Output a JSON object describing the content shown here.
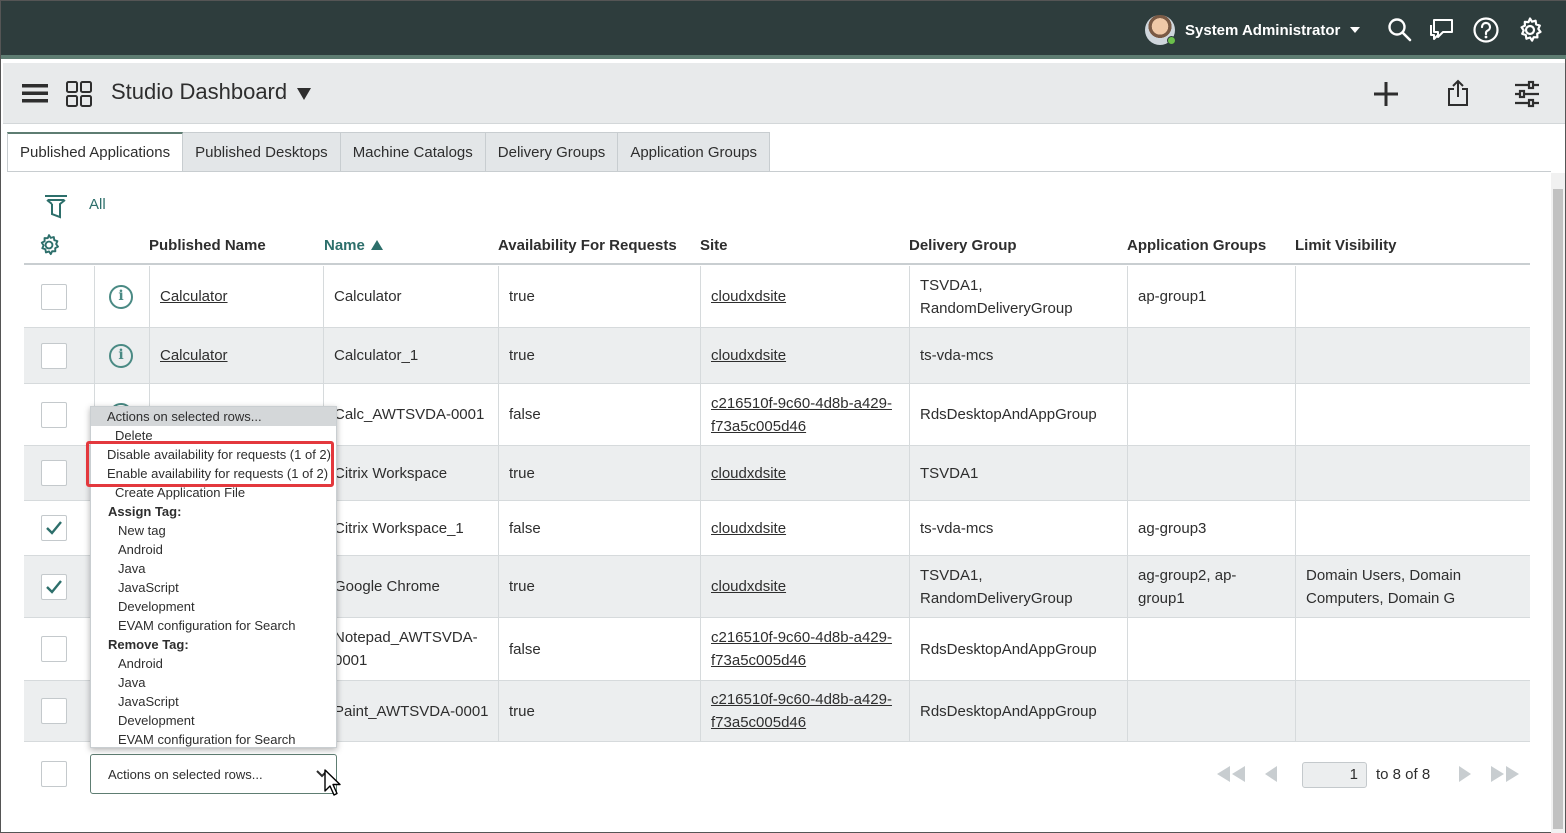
{
  "topbar": {
    "user_name": "System Administrator",
    "icons": [
      "search-icon",
      "chat-icon",
      "help-icon",
      "settings-gear-icon"
    ],
    "colors": {
      "background": "#2e3d3d",
      "accent": "#5e7d72"
    }
  },
  "header": {
    "title": "Studio Dashboard",
    "icons": [
      "hamburger-menu-icon",
      "grid-icon",
      "dropdown-triangle-icon",
      "plus-icon",
      "share-icon",
      "sliders-icon"
    ]
  },
  "tabs": [
    {
      "label": "Published Applications",
      "active": true
    },
    {
      "label": "Published Desktops",
      "active": false
    },
    {
      "label": "Machine Catalogs",
      "active": false
    },
    {
      "label": "Delivery Groups",
      "active": false
    },
    {
      "label": "Application Groups",
      "active": false
    }
  ],
  "filter": {
    "label": "All"
  },
  "table": {
    "columns": {
      "published_name": "Published Name",
      "name": "Name",
      "availability": "Availability For Requests",
      "site": "Site",
      "delivery_group": "Delivery Group",
      "application_groups": "Application Groups",
      "limit_visibility": "Limit Visibility"
    },
    "sort": {
      "column": "Name",
      "direction": "ascending"
    },
    "rows": [
      {
        "checked": false,
        "published_name": "Calculator",
        "name": "Calculator",
        "availability": "true",
        "site_1": "cloudxdsite",
        "site_2": "",
        "delivery_group_1": "TSVDA1,",
        "delivery_group_2": "RandomDeliveryGroup",
        "application_groups_1": "ap-group1",
        "application_groups_2": "",
        "limit_visibility_1": "",
        "limit_visibility_2": ""
      },
      {
        "checked": false,
        "published_name": "Calculator",
        "name": "Calculator_1",
        "availability": "true",
        "site_1": "cloudxdsite",
        "site_2": "",
        "delivery_group_1": "ts-vda-mcs",
        "delivery_group_2": "",
        "application_groups_1": "",
        "application_groups_2": "",
        "limit_visibility_1": "",
        "limit_visibility_2": ""
      },
      {
        "checked": false,
        "published_name": "",
        "name": "Calc_AWTSVDA-0001",
        "availability": "false",
        "site_1": "c216510f-9c60-4d8b-a429-",
        "site_2": "f73a5c005d46",
        "delivery_group_1": "RdsDesktopAndAppGroup",
        "delivery_group_2": "",
        "application_groups_1": "",
        "application_groups_2": "",
        "limit_visibility_1": "",
        "limit_visibility_2": ""
      },
      {
        "checked": false,
        "published_name": "",
        "name": "Citrix Workspace",
        "availability": "true",
        "site_1": "cloudxdsite",
        "site_2": "",
        "delivery_group_1": "TSVDA1",
        "delivery_group_2": "",
        "application_groups_1": "",
        "application_groups_2": "",
        "limit_visibility_1": "",
        "limit_visibility_2": ""
      },
      {
        "checked": true,
        "published_name": "",
        "name": "Citrix Workspace_1",
        "availability": "false",
        "site_1": "cloudxdsite",
        "site_2": "",
        "delivery_group_1": "ts-vda-mcs",
        "delivery_group_2": "",
        "application_groups_1": "ag-group3",
        "application_groups_2": "",
        "limit_visibility_1": "",
        "limit_visibility_2": ""
      },
      {
        "checked": true,
        "published_name": "",
        "name": "Google Chrome",
        "availability": "true",
        "site_1": "cloudxdsite",
        "site_2": "",
        "delivery_group_1": "TSVDA1,",
        "delivery_group_2": "RandomDeliveryGroup",
        "application_groups_1": "ag-group2, ap-",
        "application_groups_2": "group1",
        "limit_visibility_1": "Domain Users, Domain",
        "limit_visibility_2": "Computers, Domain G"
      },
      {
        "checked": false,
        "published_name": "",
        "name": "Notepad_AWTSVDA-",
        "name_2": "0001",
        "availability": "false",
        "site_1": "c216510f-9c60-4d8b-a429-",
        "site_2": "f73a5c005d46",
        "delivery_group_1": "RdsDesktopAndAppGroup",
        "delivery_group_2": "",
        "application_groups_1": "",
        "application_groups_2": "",
        "limit_visibility_1": "",
        "limit_visibility_2": ""
      },
      {
        "checked": false,
        "published_name": "",
        "name": "Paint_AWTSVDA-0001",
        "availability": "true",
        "site_1": "c216510f-9c60-4d8b-a429-",
        "site_2": "f73a5c005d46",
        "delivery_group_1": "RdsDesktopAndAppGroup",
        "delivery_group_2": "",
        "application_groups_1": "",
        "application_groups_2": "",
        "limit_visibility_1": "",
        "limit_visibility_2": ""
      }
    ]
  },
  "actions_menu": {
    "header": "Actions on selected rows...",
    "items": [
      {
        "label": "Delete",
        "type": "item"
      },
      {
        "label": "Disable availability for requests (1 of 2)",
        "type": "item",
        "highlighted": true
      },
      {
        "label": "Enable availability for requests (1 of 2)",
        "type": "item",
        "highlighted": true
      },
      {
        "label": "Create Application File",
        "type": "item"
      },
      {
        "label": "Assign Tag:",
        "type": "group"
      },
      {
        "label": "New tag",
        "type": "sub"
      },
      {
        "label": "Android",
        "type": "sub"
      },
      {
        "label": "Java",
        "type": "sub"
      },
      {
        "label": "JavaScript",
        "type": "sub"
      },
      {
        "label": "Development",
        "type": "sub"
      },
      {
        "label": "EVAM configuration for Search",
        "type": "sub"
      },
      {
        "label": "Remove Tag:",
        "type": "group"
      },
      {
        "label": "Android",
        "type": "sub"
      },
      {
        "label": "Java",
        "type": "sub"
      },
      {
        "label": "JavaScript",
        "type": "sub"
      },
      {
        "label": "Development",
        "type": "sub"
      },
      {
        "label": "EVAM configuration for Search",
        "type": "sub"
      }
    ],
    "highlight_color": "#e3383d"
  },
  "footer": {
    "select_value": "Actions on selected rows...",
    "page_number": "1",
    "page_total": "to 8 of 8"
  }
}
